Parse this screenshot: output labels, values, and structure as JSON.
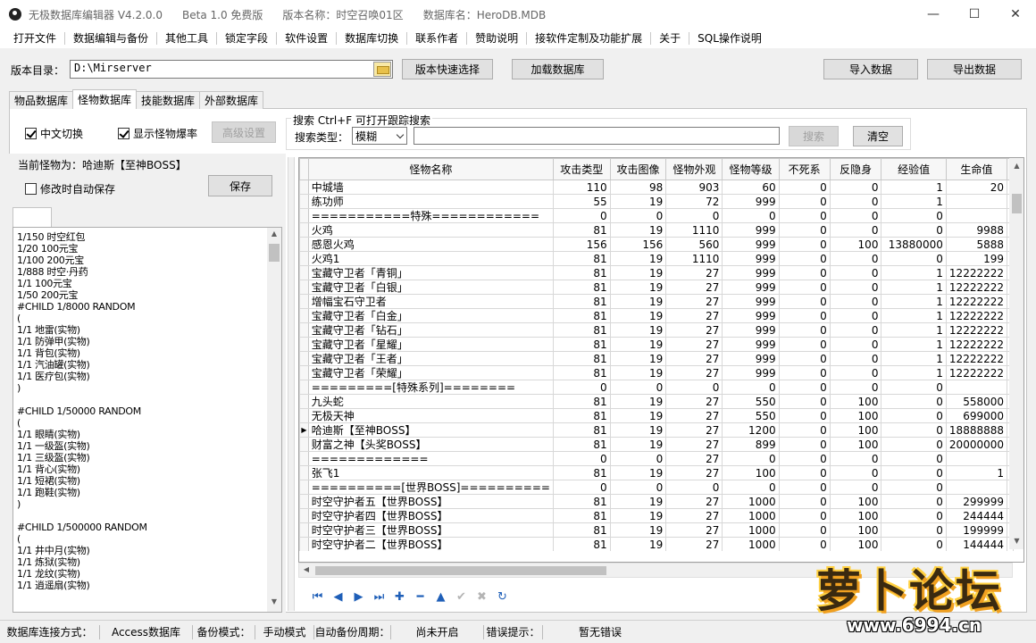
{
  "titlebar": {
    "app": "无极数据库编辑器 V4.2.0.0",
    "edition": "Beta 1.0 免费版",
    "version_name": "版本名称：时空召唤01区",
    "db_name": "数据库名：HeroDB.MDB"
  },
  "menu": [
    "打开文件",
    "数据编辑与备份",
    "其他工具",
    "锁定字段",
    "软件设置",
    "数据库切换",
    "联系作者",
    "赞助说明",
    "接软件定制及功能扩展",
    "关于",
    "SQL操作说明"
  ],
  "toolbar": {
    "dir_label": "版本目录：",
    "dir_value": "D:\\Mirserver",
    "quick_select": "版本快速选择",
    "load_db": "加载数据库",
    "import": "导入数据",
    "export": "导出数据"
  },
  "tabs": [
    "物品数据库",
    "怪物数据库",
    "技能数据库",
    "外部数据库"
  ],
  "options": {
    "chinese_switch": "中文切换",
    "show_drops": "显示怪物爆率",
    "advanced": "高级设置"
  },
  "search": {
    "legend": "搜索  Ctrl+F 可打开跟踪搜索",
    "type_label": "搜索类型：",
    "type_value": "模糊",
    "search_btn": "搜索",
    "clear_btn": "清空"
  },
  "left": {
    "current_label": "当前怪物为：哈迪斯【至神BOSS】",
    "autosave": "修改时自动保存",
    "save": "保存",
    "drop_lines": [
      "1/150 时空红包",
      "1/20 100元宝",
      "1/100 200元宝",
      "1/888 时空·丹药",
      "1/1 100元宝",
      "1/50 200元宝",
      "#CHILD 1/8000 RANDOM",
      "(",
      "1/1 地雷(实物)",
      "1/1 防弹甲(实物)",
      "1/1 背包(实物)",
      "1/1 汽油罐(实物)",
      "1/1 医疗包(实物)",
      ")",
      "",
      "#CHILD 1/50000 RANDOM",
      "(",
      "1/1 眼睛(实物)",
      "1/1 一级盔(实物)",
      "1/1 三级盔(实物)",
      "1/1 背心(实物)",
      "1/1 短裙(实物)",
      "1/1 跑鞋(实物)",
      ")",
      "",
      "#CHILD 1/500000 RANDOM",
      "(",
      "1/1 井中月(实物)",
      "1/1 炼狱(实物)",
      "1/1 龙纹(实物)",
      "1/1 逍遥扇(实物)"
    ]
  },
  "grid": {
    "columns": [
      "怪物名称",
      "攻击类型",
      "攻击图像",
      "怪物外观",
      "怪物等级",
      "不死系",
      "反隐身",
      "经验值",
      "生命值"
    ],
    "rows": [
      [
        "中城墙",
        "110",
        "98",
        "903",
        "60",
        "0",
        "0",
        "1",
        "20"
      ],
      [
        "练功师",
        "55",
        "19",
        "72",
        "999",
        "0",
        "0",
        "1",
        ""
      ],
      [
        "===========特殊============",
        "0",
        "0",
        "0",
        "0",
        "0",
        "0",
        "0",
        ""
      ],
      [
        "火鸡",
        "81",
        "19",
        "1110",
        "999",
        "0",
        "0",
        "0",
        "9988"
      ],
      [
        "感恩火鸡",
        "156",
        "156",
        "560",
        "999",
        "0",
        "100",
        "13880000",
        "5888"
      ],
      [
        "火鸡1",
        "81",
        "19",
        "1110",
        "999",
        "0",
        "0",
        "0",
        "199"
      ],
      [
        "宝藏守卫者「青铜」",
        "81",
        "19",
        "27",
        "999",
        "0",
        "0",
        "1",
        "12222222"
      ],
      [
        "宝藏守卫者「白银」",
        "81",
        "19",
        "27",
        "999",
        "0",
        "0",
        "1",
        "12222222"
      ],
      [
        "增幅宝石守卫者",
        "81",
        "19",
        "27",
        "999",
        "0",
        "0",
        "1",
        "12222222"
      ],
      [
        "宝藏守卫者「白金」",
        "81",
        "19",
        "27",
        "999",
        "0",
        "0",
        "1",
        "12222222"
      ],
      [
        "宝藏守卫者「钻石」",
        "81",
        "19",
        "27",
        "999",
        "0",
        "0",
        "1",
        "12222222"
      ],
      [
        "宝藏守卫者「星耀」",
        "81",
        "19",
        "27",
        "999",
        "0",
        "0",
        "1",
        "12222222"
      ],
      [
        "宝藏守卫者「王者」",
        "81",
        "19",
        "27",
        "999",
        "0",
        "0",
        "1",
        "12222222"
      ],
      [
        "宝藏守卫者「荣耀」",
        "81",
        "19",
        "27",
        "999",
        "0",
        "0",
        "1",
        "12222222"
      ],
      [
        "=========[特殊系列]========",
        "0",
        "0",
        "0",
        "0",
        "0",
        "0",
        "0",
        ""
      ],
      [
        "九头蛇",
        "81",
        "19",
        "27",
        "550",
        "0",
        "100",
        "0",
        "558000"
      ],
      [
        "无极天神",
        "81",
        "19",
        "27",
        "550",
        "0",
        "100",
        "0",
        "699000"
      ],
      [
        "哈迪斯【至神BOSS】",
        "81",
        "19",
        "27",
        "1200",
        "0",
        "100",
        "0",
        "18888888"
      ],
      [
        "财富之神【头奖BOSS】",
        "81",
        "19",
        "27",
        "899",
        "0",
        "100",
        "0",
        "20000000"
      ],
      [
        "=============",
        "0",
        "0",
        "27",
        "0",
        "0",
        "0",
        "0",
        ""
      ],
      [
        "张飞1",
        "81",
        "19",
        "27",
        "100",
        "0",
        "0",
        "0",
        "1"
      ],
      [
        "==========[世界BOSS]==========",
        "0",
        "0",
        "0",
        "0",
        "0",
        "0",
        "0",
        ""
      ],
      [
        "时空守护者五【世界BOSS】",
        "81",
        "19",
        "27",
        "1000",
        "0",
        "100",
        "0",
        "299999"
      ],
      [
        "时空守护者四【世界BOSS】",
        "81",
        "19",
        "27",
        "1000",
        "0",
        "100",
        "0",
        "244444"
      ],
      [
        "时空守护者三【世界BOSS】",
        "81",
        "19",
        "27",
        "1000",
        "0",
        "100",
        "0",
        "199999"
      ],
      [
        "时空守护者二【世界BOSS】",
        "81",
        "19",
        "27",
        "1000",
        "0",
        "100",
        "0",
        "144444"
      ]
    ],
    "selected_row": 17
  },
  "status": {
    "conn_label": "数据库连接方式：",
    "conn_value": "Access数据库",
    "backup_label": "备份模式：",
    "backup_value": "手动模式",
    "auto_label": "自动备份周期：",
    "auto_value": "尚未开启",
    "error_label": "错误提示：",
    "error_value": "暂无错误"
  },
  "logo": {
    "text": "萝卜论坛",
    "url": "www.6994.cn"
  }
}
